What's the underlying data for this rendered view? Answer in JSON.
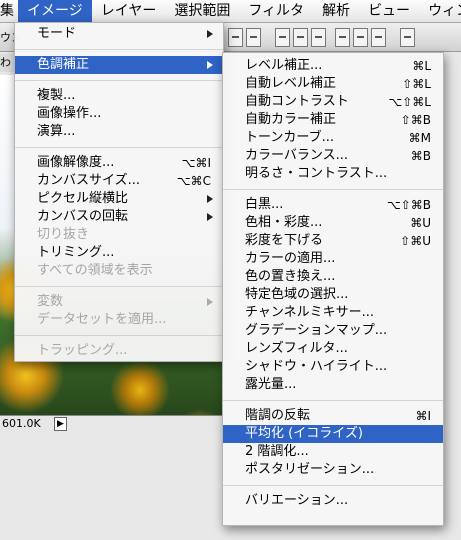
{
  "menubar": {
    "items": [
      "集",
      "イメージ",
      "レイヤー",
      "選択範囲",
      "フィルタ",
      "解析",
      "ビュー",
      "ウィン"
    ]
  },
  "toolbar": {
    "left_text": "ウン"
  },
  "leftstrip": {
    "text": "わり"
  },
  "status": {
    "doc_size": "601.0K",
    "menu_arrow": "▶"
  },
  "image_menu": {
    "mode": "モード",
    "adjustments": "色調補正",
    "duplicate": "複製...",
    "apply_image": "画像操作...",
    "calculations": "演算...",
    "image_size": "画像解像度...",
    "image_size_sc": "⌥⌘I",
    "canvas_size": "カンバスサイズ...",
    "canvas_size_sc": "⌥⌘C",
    "pixel_aspect": "ピクセル縦横比",
    "rotate_canvas": "カンバスの回転",
    "crop": "切り抜き",
    "trim": "トリミング...",
    "reveal_all": "すべての領域を表示",
    "variables": "変数",
    "apply_dataset": "データセットを適用...",
    "trap": "トラッピング..."
  },
  "adjust_menu": {
    "levels": "レベル補正...",
    "levels_sc": "⌘L",
    "auto_levels": "自動レベル補正",
    "auto_levels_sc": "⇧⌘L",
    "auto_contrast": "自動コントラスト",
    "auto_contrast_sc": "⌥⇧⌘L",
    "auto_color": "自動カラー補正",
    "auto_color_sc": "⇧⌘B",
    "curves": "トーンカーブ...",
    "curves_sc": "⌘M",
    "color_balance": "カラーバランス...",
    "color_balance_sc": "⌘B",
    "brightness": "明るさ・コントラスト...",
    "bw": "白黒...",
    "bw_sc": "⌥⇧⌘B",
    "hue_sat": "色相・彩度...",
    "hue_sat_sc": "⌘U",
    "desaturate": "彩度を下げる",
    "desaturate_sc": "⇧⌘U",
    "match_color": "カラーの適用...",
    "replace_color": "色の置き換え...",
    "selective_color": "特定色域の選択...",
    "channel_mixer": "チャンネルミキサー...",
    "gradient_map": "グラデーションマップ...",
    "photo_filter": "レンズフィルタ...",
    "shadow_highlight": "シャドウ・ハイライト...",
    "exposure": "露光量...",
    "invert": "階調の反転",
    "invert_sc": "⌘I",
    "equalize": "平均化 (イコライズ)",
    "threshold": "2 階調化...",
    "posterize": "ポスタリゼーション...",
    "variations": "バリエーション..."
  }
}
